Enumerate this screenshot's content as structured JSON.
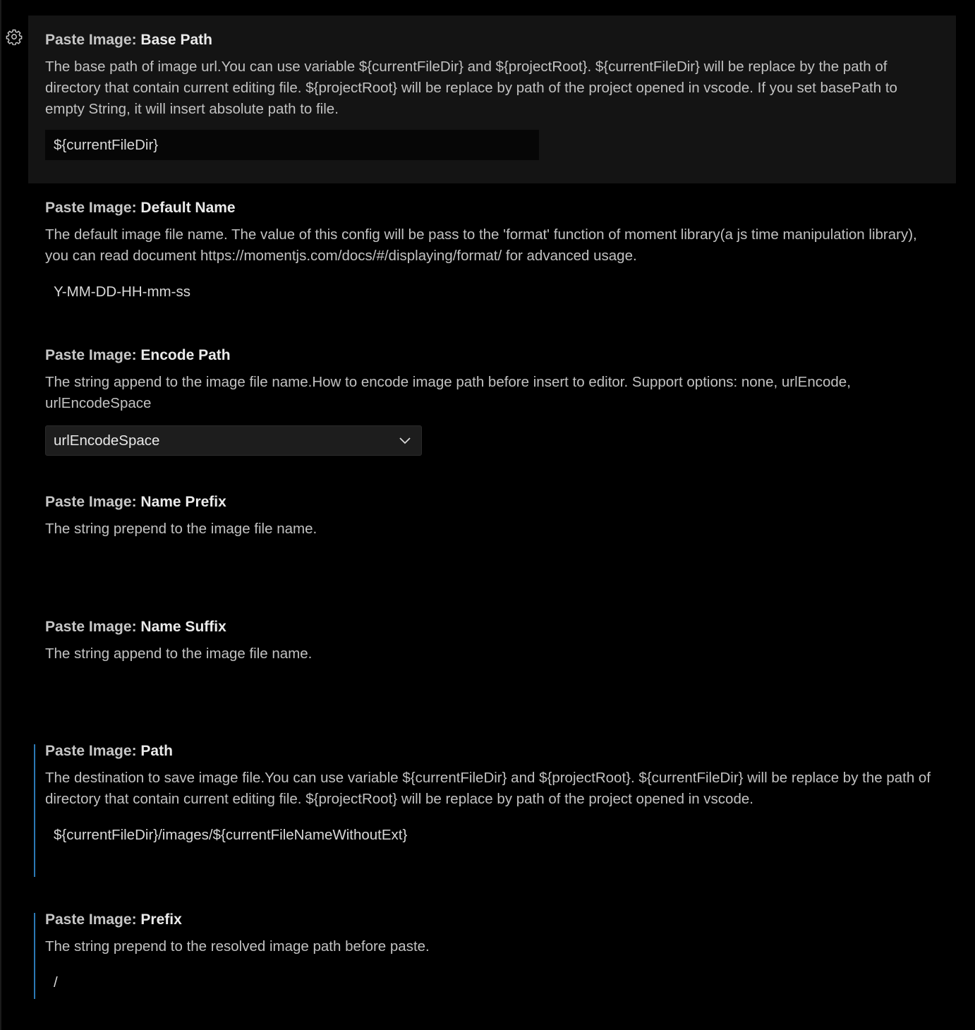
{
  "accent_color": "#2b79b5",
  "settings": [
    {
      "category": "Paste Image: ",
      "name": "Base Path",
      "description": "The base path of image url.You can use variable ${currentFileDir} and ${projectRoot}. ${currentFileDir} will be replace by the path of directory that contain current editing file. ${projectRoot} will be replace by path of the project opened in vscode. If you set basePath to empty String, it will insert absolute path to file.",
      "value": "${currentFileDir}"
    },
    {
      "category": "Paste Image: ",
      "name": "Default Name",
      "description": "The default image file name. The value of this config will be pass to the 'format' function of moment library(a js time manipulation library), you can read document https://momentjs.com/docs/#/displaying/format/ for advanced usage.",
      "value": "Y-MM-DD-HH-mm-ss"
    },
    {
      "category": "Paste Image: ",
      "name": "Encode Path",
      "description": "The string append to the image file name.How to encode image path before insert to editor. Support options: none, urlEncode, urlEncodeSpace",
      "value": "urlEncodeSpace"
    },
    {
      "category": "Paste Image: ",
      "name": "Name Prefix",
      "description": "The string prepend to the image file name.",
      "value": ""
    },
    {
      "category": "Paste Image: ",
      "name": "Name Suffix",
      "description": "The string append to the image file name.",
      "value": ""
    },
    {
      "category": "Paste Image: ",
      "name": "Path",
      "description": "The destination to save image file.You can use variable ${currentFileDir} and ${projectRoot}. ${currentFileDir} will be replace by the path of directory that contain current editing file. ${projectRoot} will be replace by path of the project opened in vscode.",
      "value": "${currentFileDir}/images/${currentFileNameWithoutExt}"
    },
    {
      "category": "Paste Image: ",
      "name": "Prefix",
      "description": "The string prepend to the resolved image path before paste.",
      "value": "/"
    }
  ]
}
